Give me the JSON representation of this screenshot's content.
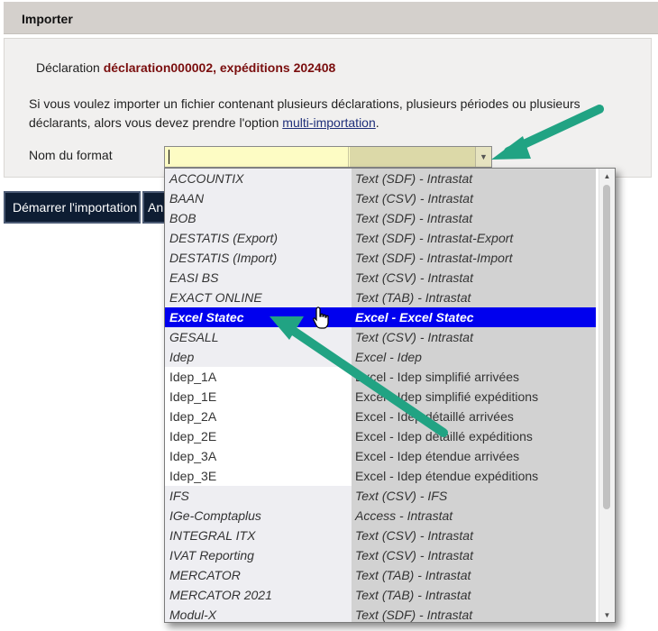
{
  "header": {
    "title": "Importer"
  },
  "declaration": {
    "label": "Déclaration ",
    "value": "déclaration000002, expéditions 202408"
  },
  "info": {
    "text": "Si vous voulez importer un fichier contenant plusieurs déclarations, plusieurs périodes ou plusieurs déclarants, alors vous devez prendre l'option ",
    "link": "multi-importation",
    "after": "."
  },
  "format": {
    "label": "Nom du format",
    "value": ""
  },
  "buttons": {
    "start": "Démarrer l'importation",
    "cancel": "Annuler"
  },
  "dropdown": {
    "options": [
      {
        "name": "ACCOUNTIX",
        "type": "Text (SDF) - Intrastat",
        "italic": true
      },
      {
        "name": "BAAN",
        "type": "Text (CSV) - Intrastat",
        "italic": true
      },
      {
        "name": "BOB",
        "type": "Text (SDF) - Intrastat",
        "italic": true
      },
      {
        "name": "DESTATIS (Export)",
        "type": "Text (SDF) - Intrastat-Export",
        "italic": true
      },
      {
        "name": "DESTATIS (Import)",
        "type": "Text (SDF) - Intrastat-Import",
        "italic": true
      },
      {
        "name": "EASI BS",
        "type": "Text (CSV) - Intrastat",
        "italic": true
      },
      {
        "name": "EXACT ONLINE",
        "type": "Text (TAB) - Intrastat",
        "italic": true
      },
      {
        "name": "Excel Statec",
        "type": "Excel - Excel Statec",
        "italic": true,
        "selected": true
      },
      {
        "name": "GESALL",
        "type": "Text (CSV) - Intrastat",
        "italic": true
      },
      {
        "name": "Idep",
        "type": "Excel - Idep",
        "italic": true
      },
      {
        "name": "Idep_1A",
        "type": "Excel - Idep simplifié arrivées",
        "italic": false
      },
      {
        "name": "Idep_1E",
        "type": "Excel - Idep simplifié expéditions",
        "italic": false
      },
      {
        "name": "Idep_2A",
        "type": "Excel - Idep détaillé arrivées",
        "italic": false
      },
      {
        "name": "Idep_2E",
        "type": "Excel - Idep détaillé expéditions",
        "italic": false
      },
      {
        "name": "Idep_3A",
        "type": "Excel - Idep étendue arrivées",
        "italic": false
      },
      {
        "name": "Idep_3E",
        "type": "Excel - Idep étendue expéditions",
        "italic": false
      },
      {
        "name": "IFS",
        "type": "Text (CSV) - IFS",
        "italic": true
      },
      {
        "name": "IGe-Comptaplus",
        "type": "Access - Intrastat",
        "italic": true
      },
      {
        "name": "INTEGRAL ITX",
        "type": "Text (CSV) - Intrastat",
        "italic": true
      },
      {
        "name": "IVAT Reporting",
        "type": "Text (CSV) - Intrastat",
        "italic": true
      },
      {
        "name": "MERCATOR",
        "type": "Text (TAB) - Intrastat",
        "italic": true
      },
      {
        "name": "MERCATOR 2021",
        "type": "Text (TAB) - Intrastat",
        "italic": true
      },
      {
        "name": "Modul-X",
        "type": "Text (SDF) - Intrastat",
        "italic": true
      }
    ]
  },
  "icons": {
    "combo_toggle": "chevron-down-icon",
    "scroll_up": "triangle-up-icon",
    "scroll_down": "triangle-down-icon",
    "cursor": "hand-pointer-icon",
    "annotation": "arrow-icon"
  },
  "colors": {
    "accent_arrow": "#21a383",
    "selected_bg": "#0000ee",
    "button_bg": "#0e1d33",
    "declaration_text": "#7a0e0e",
    "combo_bg": "#fdfcc4"
  }
}
